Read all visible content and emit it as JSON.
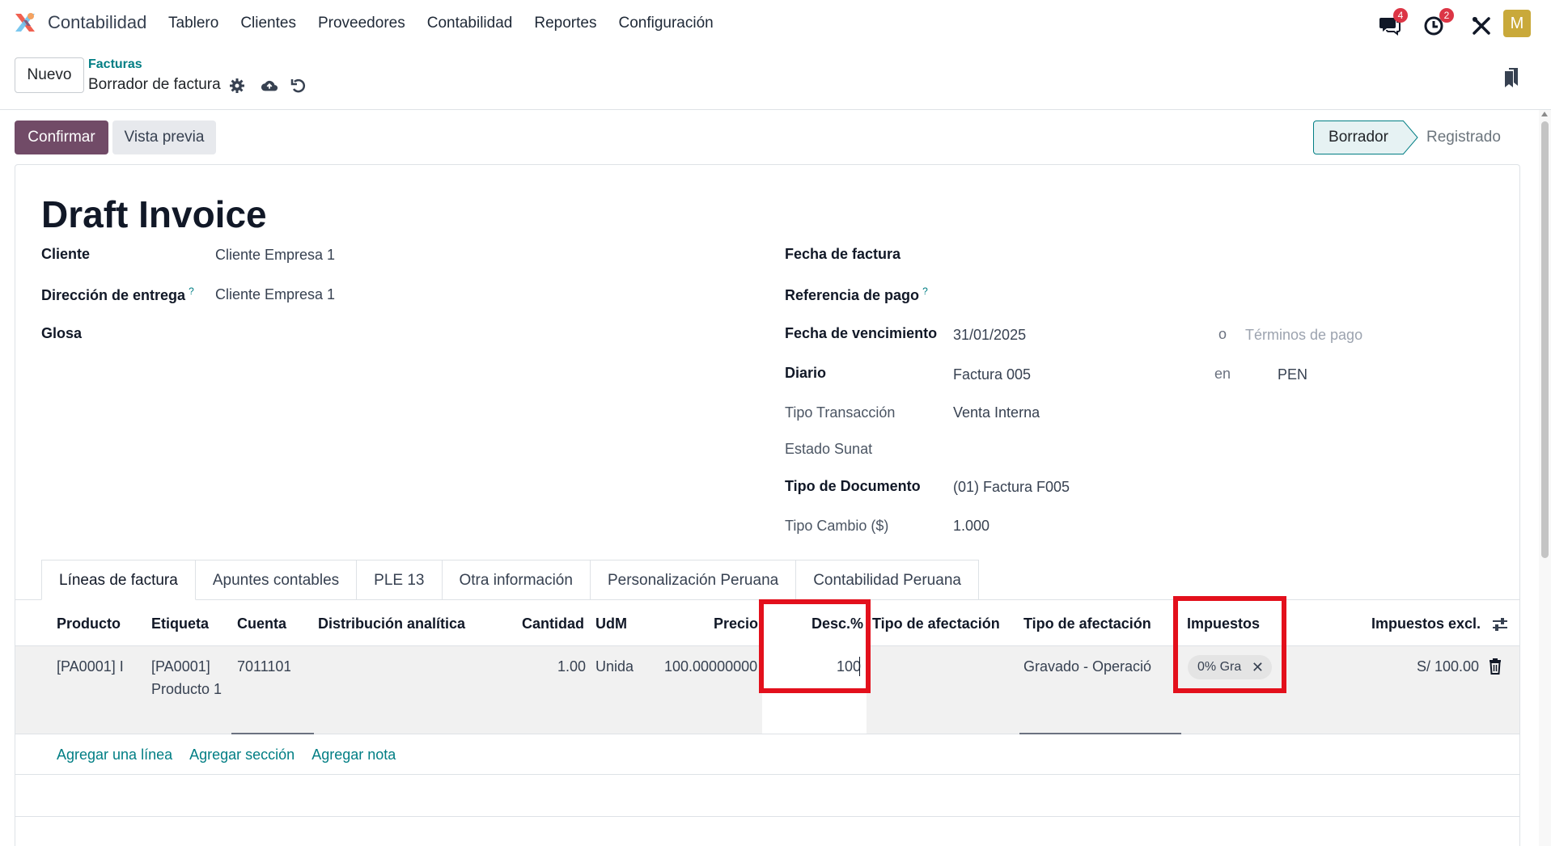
{
  "app": {
    "name": "Contabilidad",
    "menu": [
      "Tablero",
      "Clientes",
      "Proveedores",
      "Contabilidad",
      "Reportes",
      "Configuración"
    ],
    "messages_badge": "4",
    "activities_badge": "2",
    "avatar_letter": "M",
    "brand_color": "#714b67",
    "link_color": "#017e84"
  },
  "control_panel": {
    "new_button": "Nuevo",
    "breadcrumb_parent": "Facturas",
    "breadcrumb_current": "Borrador de factura"
  },
  "statusbar": {
    "confirm": "Confirmar",
    "preview": "Vista previa",
    "states": [
      "Borrador",
      "Registrado"
    ],
    "current_state": "Borrador"
  },
  "form": {
    "title": "Draft Invoice",
    "left": {
      "cliente_label": "Cliente",
      "cliente_value": "Cliente Empresa 1",
      "direccion_label": "Dirección de entrega",
      "direccion_value": "Cliente Empresa 1",
      "glosa_label": "Glosa"
    },
    "right": {
      "fecha_factura_label": "Fecha de factura",
      "referencia_label": "Referencia de pago",
      "vencimiento_label": "Fecha de vencimiento",
      "vencimiento_value": "31/01/2025",
      "o_label": "o",
      "terminos_placeholder": "Términos de pago",
      "diario_label": "Diario",
      "diario_value": "Factura 005",
      "en_label": "en",
      "moneda_value": "PEN",
      "tipo_transaccion_label": "Tipo Transacción",
      "tipo_transaccion_value": "Venta Interna",
      "estado_sunat_label": "Estado Sunat",
      "tipo_documento_label": "Tipo de Documento",
      "tipo_documento_value": "(01) Factura F005",
      "tipo_cambio_label": "Tipo Cambio ($)",
      "tipo_cambio_value": "1.000"
    },
    "help_mark": "?"
  },
  "tabs": [
    "Líneas de factura",
    "Apuntes contables",
    "PLE 13",
    "Otra información",
    "Personalización Peruana",
    "Contabilidad Peruana"
  ],
  "lines": {
    "headers": {
      "producto": "Producto",
      "etiqueta": "Etiqueta",
      "cuenta": "Cuenta",
      "distribucion": "Distribución analítica",
      "cantidad": "Cantidad",
      "udm": "UdM",
      "precio": "Precio",
      "desc": "Desc.%",
      "tipo_afectacion_1": "Tipo de afectación",
      "tipo_afectacion_2": "Tipo de afectación",
      "impuestos": "Impuestos",
      "impuestos_excl": "Impuestos excl."
    },
    "row": {
      "producto": "[PA0001] I",
      "etiqueta_1": "[PA0001]",
      "etiqueta_2": "Producto 1",
      "cuenta": "7011101",
      "cantidad": "1.00",
      "udm": "Unida",
      "precio": "100.00000000",
      "desc": "100",
      "tipo_afectacion": "Gravado - Operació",
      "impuesto_chip": "0% Gra",
      "subtotal": "S/ 100.00"
    },
    "add_links": [
      "Agregar una línea",
      "Agregar sección",
      "Agregar nota"
    ]
  }
}
